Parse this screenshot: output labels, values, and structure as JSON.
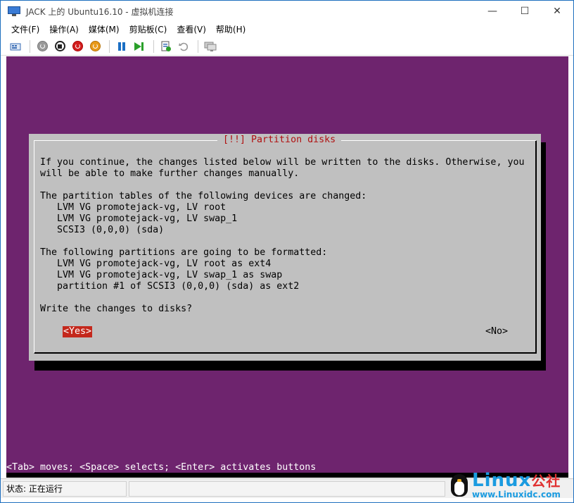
{
  "window": {
    "title": "JACK 上的 Ubuntu16.10 - 虚拟机连接",
    "minimize_glyph": "—",
    "maximize_glyph": "☐",
    "close_glyph": "✕"
  },
  "menu": {
    "items": [
      "文件(F)",
      "操作(A)",
      "媒体(M)",
      "剪贴板(C)",
      "查看(V)",
      "帮助(H)"
    ]
  },
  "toolbar": {
    "icons": [
      "ctrl-alt-del-icon",
      "start-icon",
      "turn-off-icon",
      "shutdown-icon",
      "save-icon",
      "pause-icon",
      "reset-icon",
      "checkpoint-icon",
      "revert-icon",
      "enhanced-session-icon"
    ]
  },
  "dialog": {
    "title": "[!!] Partition disks",
    "lines": [
      "If you continue, the changes listed below will be written to the disks. Otherwise, you",
      "will be able to make further changes manually.",
      "",
      "The partition tables of the following devices are changed:",
      "   LVM VG promotejack-vg, LV root",
      "   LVM VG promotejack-vg, LV swap_1",
      "   SCSI3 (0,0,0) (sda)",
      "",
      "The following partitions are going to be formatted:",
      "   LVM VG promotejack-vg, LV root as ext4",
      "   LVM VG promotejack-vg, LV swap_1 as swap",
      "   partition #1 of SCSI3 (0,0,0) (sda) as ext2",
      "",
      "Write the changes to disks?"
    ],
    "yes_label": "<Yes>",
    "no_label": "<No>"
  },
  "hint": "<Tab> moves; <Space> selects; <Enter> activates buttons",
  "status": {
    "text": "状态: 正在运行"
  },
  "logo": {
    "main": "Linux",
    "cn": "公社",
    "url": "www.Linuxidc.com"
  },
  "colors": {
    "vm_background": "#6e246e",
    "dialog_background": "#c0c0c0",
    "dialog_title": "#b01010",
    "selected_button": "#c4281c"
  }
}
